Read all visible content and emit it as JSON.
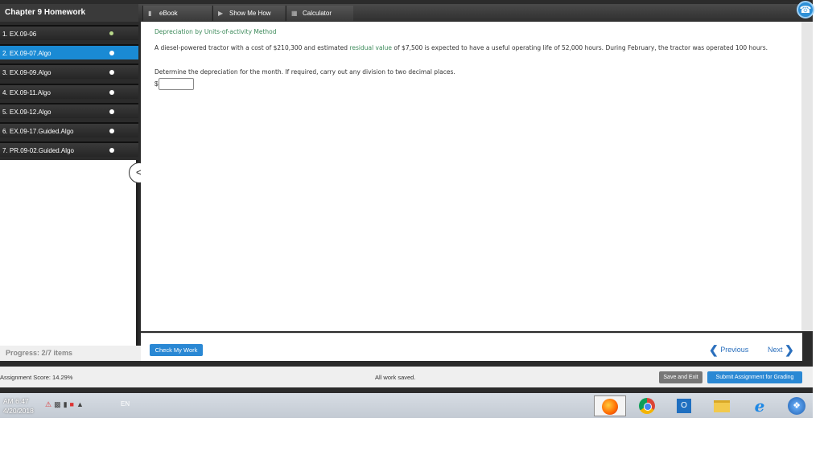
{
  "header": {
    "chapter_title": "Chapter 9 Homework",
    "tools": [
      {
        "label": "eBook",
        "icon": "book-icon"
      },
      {
        "label": "Show Me How",
        "icon": "video-icon"
      },
      {
        "label": "Calculator",
        "icon": "calculator-icon"
      }
    ],
    "help_icon": "headset-icon"
  },
  "sidebar": {
    "items": [
      {
        "label": "1. EX.09-06",
        "status": "done"
      },
      {
        "label": "2. EX.09-07.Algo",
        "status": "active"
      },
      {
        "label": "3. EX.09-09.Algo",
        "status": "todo"
      },
      {
        "label": "4. EX.09-11.Algo",
        "status": "todo"
      },
      {
        "label": "5. EX.09-12.Algo",
        "status": "todo"
      },
      {
        "label": "6. EX.09-17.Guided.Algo",
        "status": "todo"
      },
      {
        "label": "7. PR.09-02.Guided.Algo",
        "status": "todo"
      }
    ],
    "progress": "Progress: 2/7 items",
    "collapse_glyph": "<"
  },
  "question": {
    "title": "Depreciation by Units-of-activity Method",
    "text_part1": "A diesel-powered tractor with a cost of $210,300 and estimated ",
    "text_term": "residual value",
    "text_part2": " of $7,500 is expected to have a useful operating life of 52,000 hours. During February, the tractor was operated 100 hours.",
    "instruction": "Determine the depreciation for the month. If required, carry out any division to two decimal places.",
    "currency_symbol": "$",
    "answer_value": ""
  },
  "nav": {
    "check_label": "Check My Work",
    "previous_label": "Previous",
    "next_label": "Next"
  },
  "status": {
    "score": "Assignment Score: 14.29%",
    "saved": "All work saved.",
    "save_exit_label": "Save and Exit",
    "submit_label": "Submit Assignment for Grading"
  },
  "taskbar": {
    "time": "AM 6:47",
    "date": "4/20/2018",
    "language": "EN",
    "apps": [
      "firefox-icon",
      "chrome-icon",
      "outlook-icon",
      "file-explorer-icon",
      "internet-explorer-icon",
      "windows-start-icon"
    ]
  }
}
